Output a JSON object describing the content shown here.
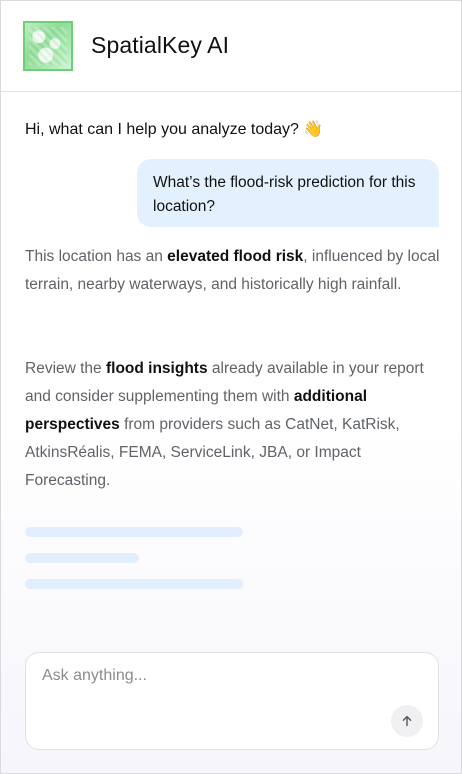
{
  "app": {
    "title": "SpatialKey AI"
  },
  "chat": {
    "greeting": "Hi, what can I help you analyze today?",
    "greeting_emoji": "👋",
    "user_message": "What’s the flood-risk prediction for this location?",
    "reply_paragraph_1": [
      {
        "text": "This location has an ",
        "bold": false
      },
      {
        "text": "elevated flood risk",
        "bold": true
      },
      {
        "text": ", influenced by local terrain, nearby waterways, and historically high rainfall.",
        "bold": false
      }
    ],
    "reply_paragraph_2": [
      {
        "text": "Review the ",
        "bold": false
      },
      {
        "text": "flood insights",
        "bold": true
      },
      {
        "text": " already available in your report and consider supplementing them with ",
        "bold": false
      },
      {
        "text": "additional perspectives",
        "bold": true
      },
      {
        "text": " from providers such as CatNet, KatRisk, AtkinsRéalis, FEMA, ServiceLink, JBA, or Impact Forecasting.",
        "bold": false
      }
    ],
    "loading_lines": 3
  },
  "composer": {
    "placeholder": "Ask anything...",
    "value": "",
    "send_icon": "arrow-up-icon"
  },
  "colors": {
    "user_bubble": "#e3f0fd",
    "skeleton": "#e2eefb",
    "logo_accent": "#6ecf78",
    "muted_text": "#5f6368"
  }
}
